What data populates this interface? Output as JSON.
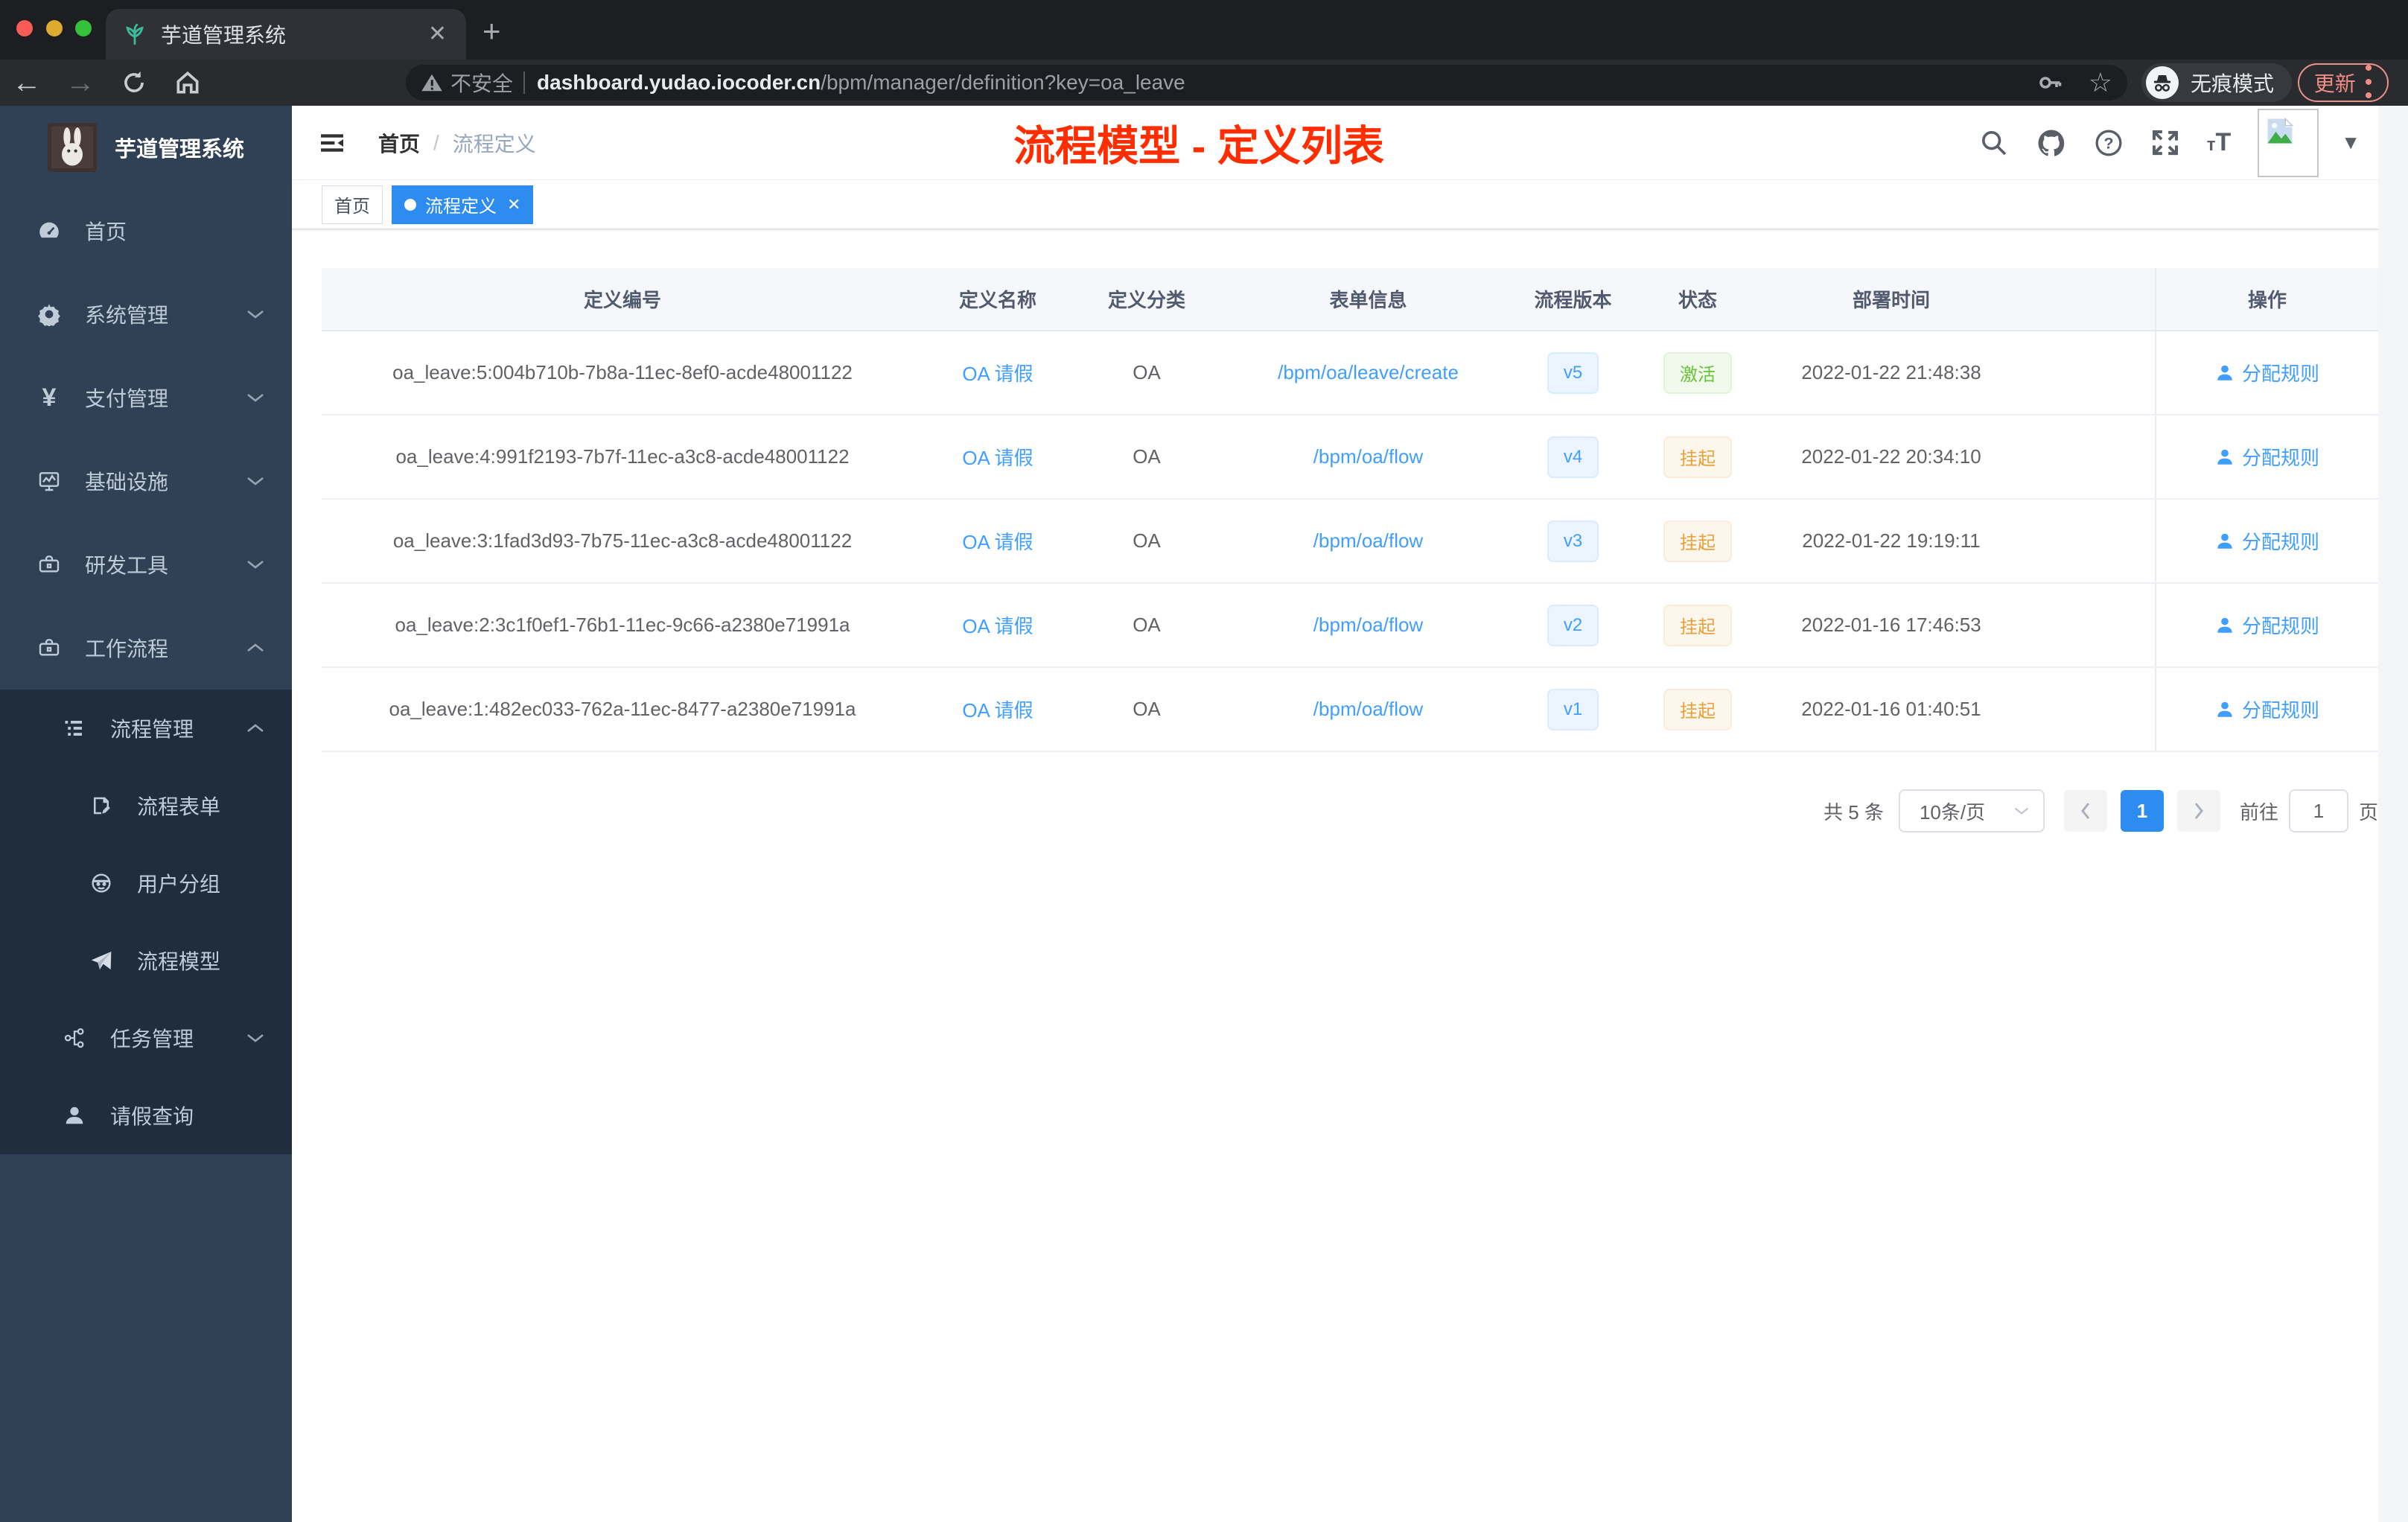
{
  "colors": {
    "accent_blue": "#409eff",
    "tag_active_blue": "#2d8cf0",
    "annotation_red": "#ff2d00",
    "status_active_green": "#67c23a",
    "status_suspended_yellow": "#e6a23c",
    "sidebar_bg": "#304156",
    "sidebar_submenu_bg": "#1f2d3d"
  },
  "browser": {
    "tab_title": "芋道管理系统",
    "security_label": "不安全",
    "url_domain": "dashboard.yudao.iocoder.cn",
    "url_path": "/bpm/manager/definition?key=oa_leave",
    "incognito_label": "无痕模式",
    "update_label": "更新"
  },
  "sidebar": {
    "app_title": "芋道管理系统",
    "items": [
      {
        "label": "首页"
      },
      {
        "label": "系统管理"
      },
      {
        "label": "支付管理"
      },
      {
        "label": "基础设施"
      },
      {
        "label": "研发工具"
      },
      {
        "label": "工作流程"
      }
    ],
    "workflow": {
      "process_mgmt": {
        "label": "流程管理"
      },
      "children": [
        {
          "label": "流程表单"
        },
        {
          "label": "用户分组"
        },
        {
          "label": "流程模型"
        }
      ],
      "task_mgmt": {
        "label": "任务管理"
      },
      "leave_query": {
        "label": "请假查询"
      }
    }
  },
  "header": {
    "breadcrumb": {
      "home": "首页",
      "separator": "/",
      "current": "流程定义"
    },
    "annotation": {
      "text": "流程模型 - 定义列表",
      "color": "#ff2d00"
    }
  },
  "tags": [
    {
      "label": "首页",
      "active": false
    },
    {
      "label": "流程定义",
      "active": true
    }
  ],
  "table": {
    "headers": [
      "定义编号",
      "定义名称",
      "定义分类",
      "表单信息",
      "流程版本",
      "状态",
      "部署时间",
      "操作"
    ],
    "rows": [
      {
        "id": "oa_leave:5:004b710b-7b8a-11ec-8ef0-acde48001122",
        "name": "OA 请假",
        "category": "OA",
        "form": "/bpm/oa/leave/create",
        "version": "v5",
        "status": {
          "label": "激活",
          "type": "active"
        },
        "time": "2022-01-22 21:48:38",
        "action": "分配规则"
      },
      {
        "id": "oa_leave:4:991f2193-7b7f-11ec-a3c8-acde48001122",
        "name": "OA 请假",
        "category": "OA",
        "form": "/bpm/oa/flow",
        "version": "v4",
        "status": {
          "label": "挂起",
          "type": "suspended"
        },
        "time": "2022-01-22 20:34:10",
        "action": "分配规则"
      },
      {
        "id": "oa_leave:3:1fad3d93-7b75-11ec-a3c8-acde48001122",
        "name": "OA 请假",
        "category": "OA",
        "form": "/bpm/oa/flow",
        "version": "v3",
        "status": {
          "label": "挂起",
          "type": "suspended"
        },
        "time": "2022-01-22 19:19:11",
        "action": "分配规则"
      },
      {
        "id": "oa_leave:2:3c1f0ef1-76b1-11ec-9c66-a2380e71991a",
        "name": "OA 请假",
        "category": "OA",
        "form": "/bpm/oa/flow",
        "version": "v2",
        "status": {
          "label": "挂起",
          "type": "suspended"
        },
        "time": "2022-01-16 17:46:53",
        "action": "分配规则"
      },
      {
        "id": "oa_leave:1:482ec033-762a-11ec-8477-a2380e71991a",
        "name": "OA 请假",
        "category": "OA",
        "form": "/bpm/oa/flow",
        "version": "v1",
        "status": {
          "label": "挂起",
          "type": "suspended"
        },
        "time": "2022-01-16 01:40:51",
        "action": "分配规则"
      }
    ]
  },
  "pagination": {
    "total": "共 5 条",
    "page_size": "10条/页",
    "current": "1",
    "goto_label": "前往",
    "goto_value": "1",
    "unit": "页"
  }
}
